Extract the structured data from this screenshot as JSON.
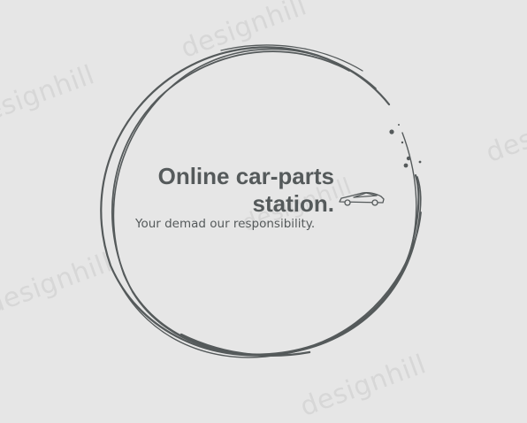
{
  "brand": {
    "title_line1": "Online car-parts",
    "title_line2": "station.",
    "tagline": "Your demad our responsibility.",
    "text_color": "#555a5b",
    "background_color": "#e6e6e6"
  },
  "watermark": {
    "text": "designhill",
    "color": "#d7d7d7"
  },
  "graphics": {
    "emblem": "hand-drawn-circle",
    "vehicle_icon": "sports-car-icon",
    "decoration": "dots"
  }
}
